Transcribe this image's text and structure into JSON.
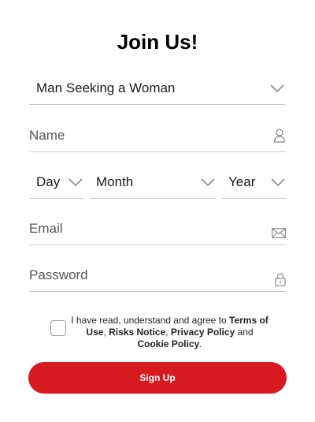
{
  "form": {
    "title": "Join Us!",
    "seeking_value": "Man Seeking a Woman",
    "name_placeholder": "Name",
    "day_placeholder": "Day",
    "month_placeholder": "Month",
    "year_placeholder": "Year",
    "email_placeholder": "Email",
    "password_placeholder": "Password",
    "consent": {
      "prefix": "I have read, understand and agree to ",
      "terms": "Terms of Use",
      "comma": ", ",
      "risks": "Risks Notice",
      "comma2": ", ",
      "privacy": "Privacy Policy",
      "and": " and ",
      "cookie": "Cookie Policy",
      "suffix": "."
    },
    "signup_label": "Sign Up"
  },
  "icons": {
    "seeking": "chevron-down-icon",
    "name": "user-icon",
    "day": "chevron-down-icon",
    "month": "chevron-down-icon",
    "year": "chevron-down-icon",
    "email": "envelope-icon",
    "password": "lock-icon"
  },
  "colors": {
    "accent": "#d71920",
    "border": "#c8c8c8",
    "icon": "#8a8a8a"
  }
}
